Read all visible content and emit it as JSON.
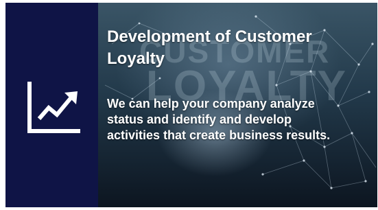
{
  "card": {
    "title": "Development of Customer Loyalty",
    "description": "We can help your company analyze status and identify and develop activities that create business results.",
    "icon": "line-chart-trend-up-icon",
    "background_watermark": [
      "CUSTOMER",
      "LOYALTY"
    ]
  },
  "colors": {
    "icon_panel": "#0f1446",
    "text": "#ffffff"
  }
}
